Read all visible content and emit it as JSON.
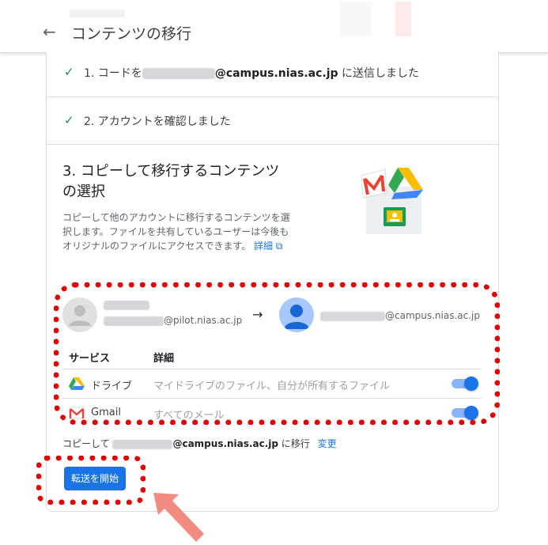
{
  "topbar": {
    "title": "コンテンツの移行",
    "back_icon": "arrow-left-icon"
  },
  "steps": [
    {
      "prefix": "1. コードを",
      "email_domain": "@campus.nias.ac.jp",
      "suffix": " に送信しました",
      "status": "done"
    },
    {
      "text": "2. アカウントを確認しました",
      "status": "done"
    }
  ],
  "section": {
    "title": "3. コピーして移行するコンテンツの選択",
    "description": "コピーして他のアカウントに移行するコンテンツを選択します。ファイルを共有しているユーザーは今後もオリジナルのファイルにアクセスできます。",
    "link_label": "詳細"
  },
  "accounts": {
    "from_email_domain": "@pilot.nias.ac.jp",
    "to_email_domain": "@campus.nias.ac.jp"
  },
  "services_table": {
    "headers": {
      "service": "サービス",
      "detail": "詳細"
    },
    "rows": [
      {
        "name": "ドライブ",
        "detail": "マイドライブのファイル、自分が所有するファイル",
        "icon": "google-drive-icon",
        "enabled": true
      },
      {
        "name": "Gmail",
        "detail": "すべてのメール",
        "icon": "gmail-icon",
        "enabled": true
      }
    ]
  },
  "copy_target": {
    "prefix": "コピーして ",
    "email_domain": "@campus.nias.ac.jp",
    "suffix": " に移行",
    "change_label": "変更"
  },
  "start_button": {
    "label": "転送を開始"
  },
  "colors": {
    "accent": "#1a73e8",
    "check": "#1e8e3e",
    "highlight": "#e00000",
    "arrow": "#f28b82"
  }
}
